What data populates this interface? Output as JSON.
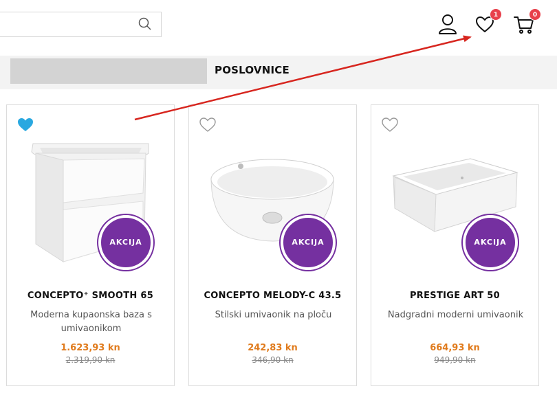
{
  "header": {
    "search": {
      "placeholder": "",
      "value": ""
    },
    "wishlist_count": "1",
    "cart_count": "0"
  },
  "nav": {
    "link_label": "POSLOVNICE"
  },
  "products": [
    {
      "title": "CONCEPTO⁺ SMOOTH 65",
      "description": "Moderna kupaonska baza s umivaonikom",
      "price": "1.623,93 kn",
      "old_price": "2.319,90 kn",
      "badge": "AKCIJA",
      "wishlisted": true
    },
    {
      "title": "CONCEPTO MELODY-C 43.5",
      "description": "Stilski umivaonik na ploču",
      "price": "242,83 kn",
      "old_price": "346,90 kn",
      "badge": "AKCIJA",
      "wishlisted": false
    },
    {
      "title": "PRESTIGE ART 50",
      "description": "Nadgradni moderni umivaonik",
      "price": "664,93 kn",
      "old_price": "949,90 kn",
      "badge": "AKCIJA",
      "wishlisted": false
    }
  ],
  "colors": {
    "accent_purple": "#7530a0",
    "price_orange": "#e07b1d",
    "badge_red": "#e8414c",
    "wishlist_active": "#29a8e0",
    "annotation_arrow": "#d7261f"
  }
}
